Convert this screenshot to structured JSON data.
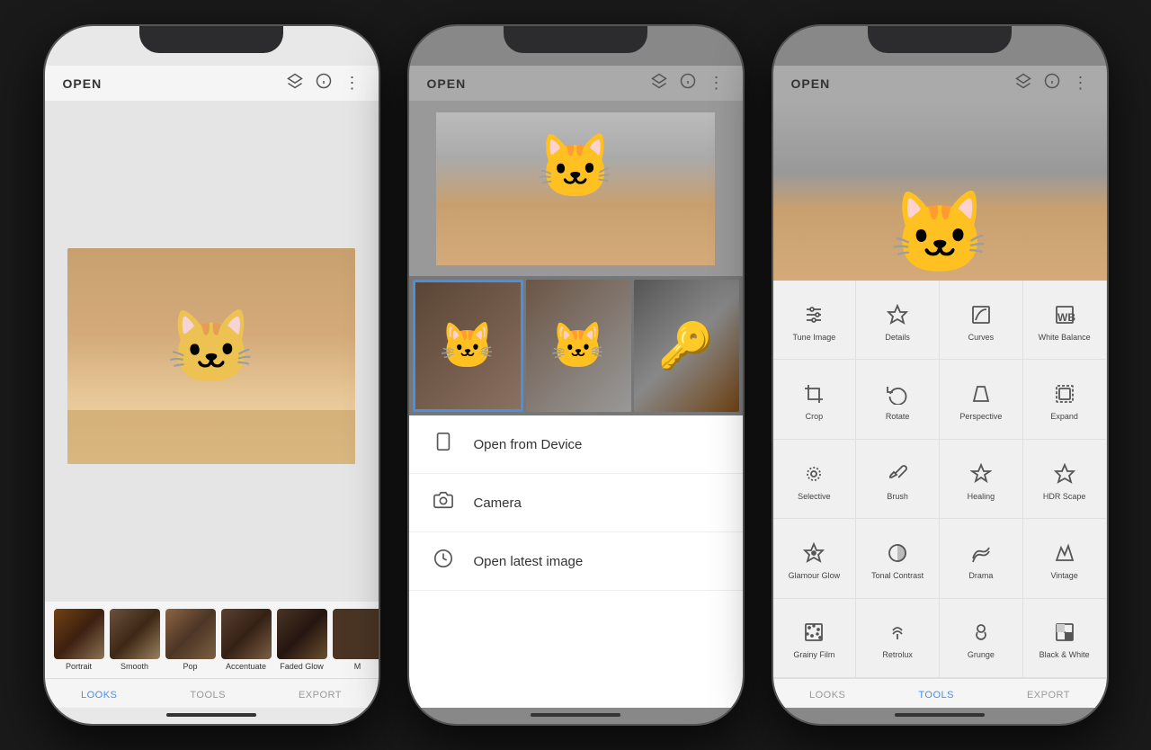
{
  "phones": [
    {
      "id": "phone1",
      "topBar": {
        "title": "OPEN",
        "icons": [
          "layers",
          "info",
          "more"
        ]
      },
      "filters": [
        {
          "label": "Portrait",
          "active": false
        },
        {
          "label": "Smooth",
          "active": false
        },
        {
          "label": "Pop",
          "active": false
        },
        {
          "label": "Accentuate",
          "active": false
        },
        {
          "label": "Faded Glow",
          "active": false
        },
        {
          "label": "M",
          "active": false
        }
      ],
      "nav": [
        {
          "label": "LOOKS",
          "active": true
        },
        {
          "label": "TOOLS",
          "active": false
        },
        {
          "label": "EXPORT",
          "active": false
        }
      ]
    },
    {
      "id": "phone2",
      "topBar": {
        "title": "OPEN",
        "icons": [
          "layers",
          "info",
          "more"
        ]
      },
      "galleryItems": [
        {
          "selected": true
        },
        {
          "selected": false
        },
        {
          "selected": false
        }
      ],
      "menuItems": [
        {
          "icon": "📱",
          "label": "Open from Device"
        },
        {
          "icon": "📷",
          "label": "Camera"
        },
        {
          "icon": "🕐",
          "label": "Open latest image"
        }
      ]
    },
    {
      "id": "phone3",
      "topBar": {
        "title": "OPEN",
        "icons": [
          "layers",
          "info",
          "more"
        ]
      },
      "tools": [
        {
          "icon": "tune",
          "label": "Tune Image"
        },
        {
          "icon": "details",
          "label": "Details"
        },
        {
          "icon": "curves",
          "label": "Curves"
        },
        {
          "icon": "wb",
          "label": "White Balance"
        },
        {
          "icon": "crop",
          "label": "Crop"
        },
        {
          "icon": "rotate",
          "label": "Rotate"
        },
        {
          "icon": "perspective",
          "label": "Perspective"
        },
        {
          "icon": "expand",
          "label": "Expand"
        },
        {
          "icon": "selective",
          "label": "Selective"
        },
        {
          "icon": "brush",
          "label": "Brush"
        },
        {
          "icon": "healing",
          "label": "Healing"
        },
        {
          "icon": "hdr",
          "label": "HDR Scape"
        },
        {
          "icon": "glamour",
          "label": "Glamour Glow"
        },
        {
          "icon": "tonal",
          "label": "Tonal Contrast"
        },
        {
          "icon": "drama",
          "label": "Drama"
        },
        {
          "icon": "vintage",
          "label": "Vintage"
        },
        {
          "icon": "grainy",
          "label": "Grainy Film"
        },
        {
          "icon": "retrolux",
          "label": "Retrolux"
        },
        {
          "icon": "grunge",
          "label": "Grunge"
        },
        {
          "icon": "bw",
          "label": "Black & White"
        }
      ],
      "nav": [
        {
          "label": "LOOKS",
          "active": false
        },
        {
          "label": "TOOLS",
          "active": true
        },
        {
          "label": "EXPORT",
          "active": false
        }
      ]
    }
  ]
}
